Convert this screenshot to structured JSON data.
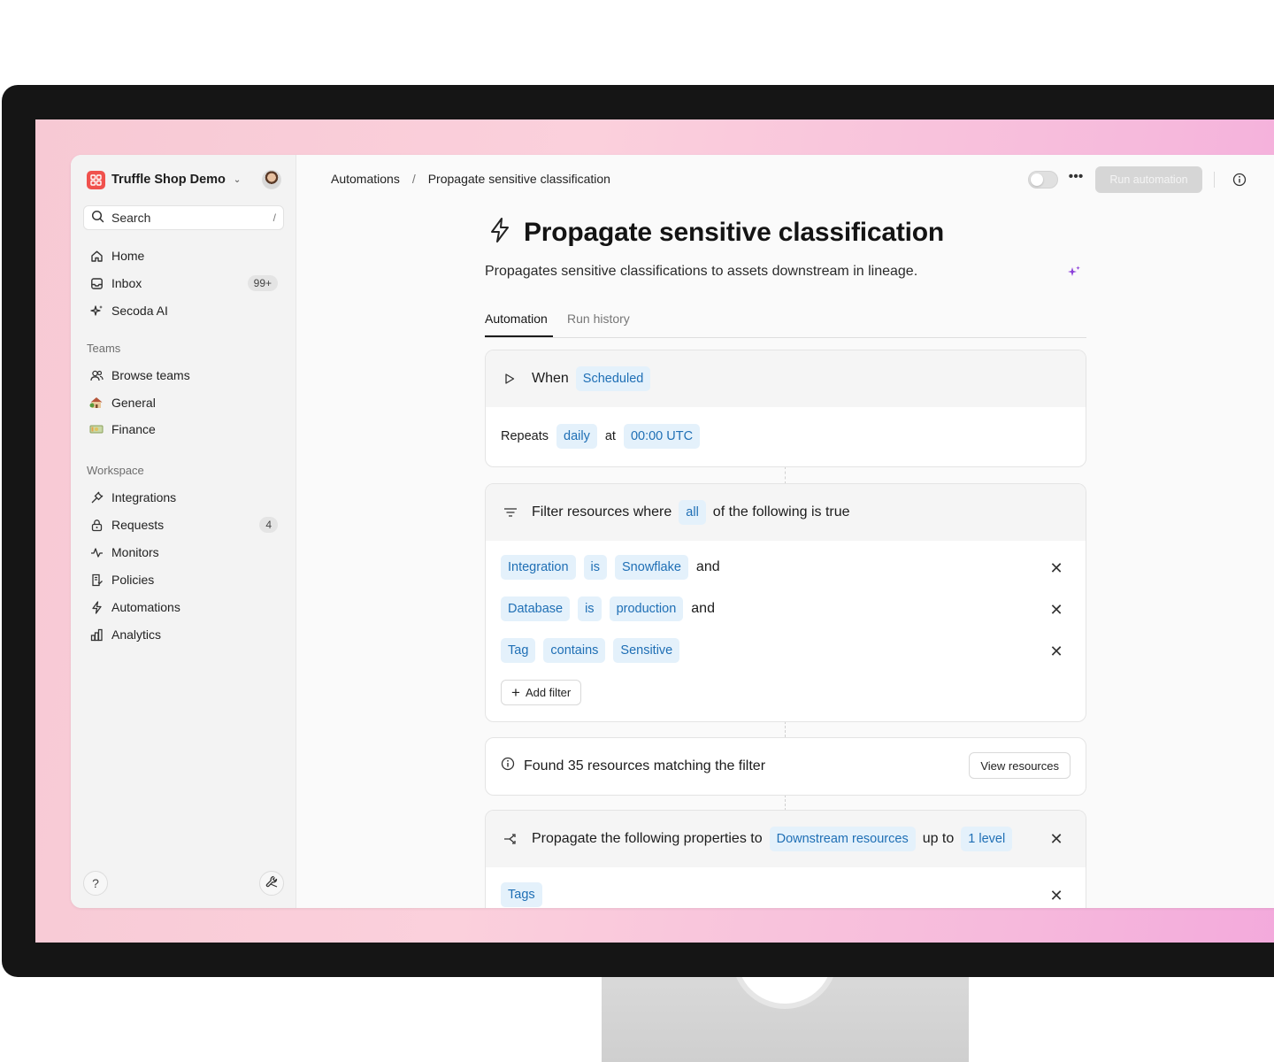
{
  "sidebar": {
    "workspace_name": "Truffle Shop Demo",
    "search_label": "Search",
    "search_shortcut": "/",
    "nav_top": [
      {
        "label": "Home",
        "icon": "home-icon"
      },
      {
        "label": "Inbox",
        "icon": "inbox-icon",
        "badge": "99+"
      },
      {
        "label": "Secoda AI",
        "icon": "sparkle-icon"
      }
    ],
    "teams_label": "Teams",
    "teams": [
      {
        "label": "Browse teams",
        "icon": "users-icon"
      },
      {
        "label": "General",
        "icon": "house-emoji-icon"
      },
      {
        "label": "Finance",
        "icon": "money-emoji-icon"
      }
    ],
    "workspace_label": "Workspace",
    "workspace_items": [
      {
        "label": "Integrations",
        "icon": "plug-icon"
      },
      {
        "label": "Requests",
        "icon": "lock-icon",
        "badge": "4"
      },
      {
        "label": "Monitors",
        "icon": "pulse-icon"
      },
      {
        "label": "Policies",
        "icon": "policy-icon"
      },
      {
        "label": "Automations",
        "icon": "bolt-icon"
      },
      {
        "label": "Analytics",
        "icon": "chart-icon"
      }
    ]
  },
  "header": {
    "breadcrumb_root": "Automations",
    "breadcrumb_sep": "/",
    "breadcrumb_current": "Propagate sensitive classification",
    "run_button": "Run automation",
    "more": "•••"
  },
  "page": {
    "title": "Propagate sensitive classification",
    "description": "Propagates sensitive classifications to assets downstream in lineage.",
    "tabs": [
      "Automation",
      "Run history"
    ]
  },
  "trigger": {
    "when_label": "When",
    "when_value": "Scheduled",
    "repeats_label": "Repeats",
    "frequency": "daily",
    "at_label": "at",
    "time": "00:00 UTC"
  },
  "filter": {
    "head_prefix": "Filter resources where",
    "quantifier": "all",
    "head_suffix": "of the following is true",
    "conditions": [
      {
        "field": "Integration",
        "op": "is",
        "value": "Snowflake",
        "joiner": "and"
      },
      {
        "field": "Database",
        "op": "is",
        "value": "production",
        "joiner": "and"
      },
      {
        "field": "Tag",
        "op": "contains",
        "value": "Sensitive",
        "joiner": ""
      }
    ],
    "add_filter": "Add filter"
  },
  "match": {
    "text": "Found 35 resources matching the filter",
    "view_button": "View resources"
  },
  "propagate": {
    "prefix": "Propagate the following properties to",
    "target": "Downstream resources",
    "up_to": "up to",
    "depth": "1 level",
    "properties": [
      "Tags"
    ]
  }
}
